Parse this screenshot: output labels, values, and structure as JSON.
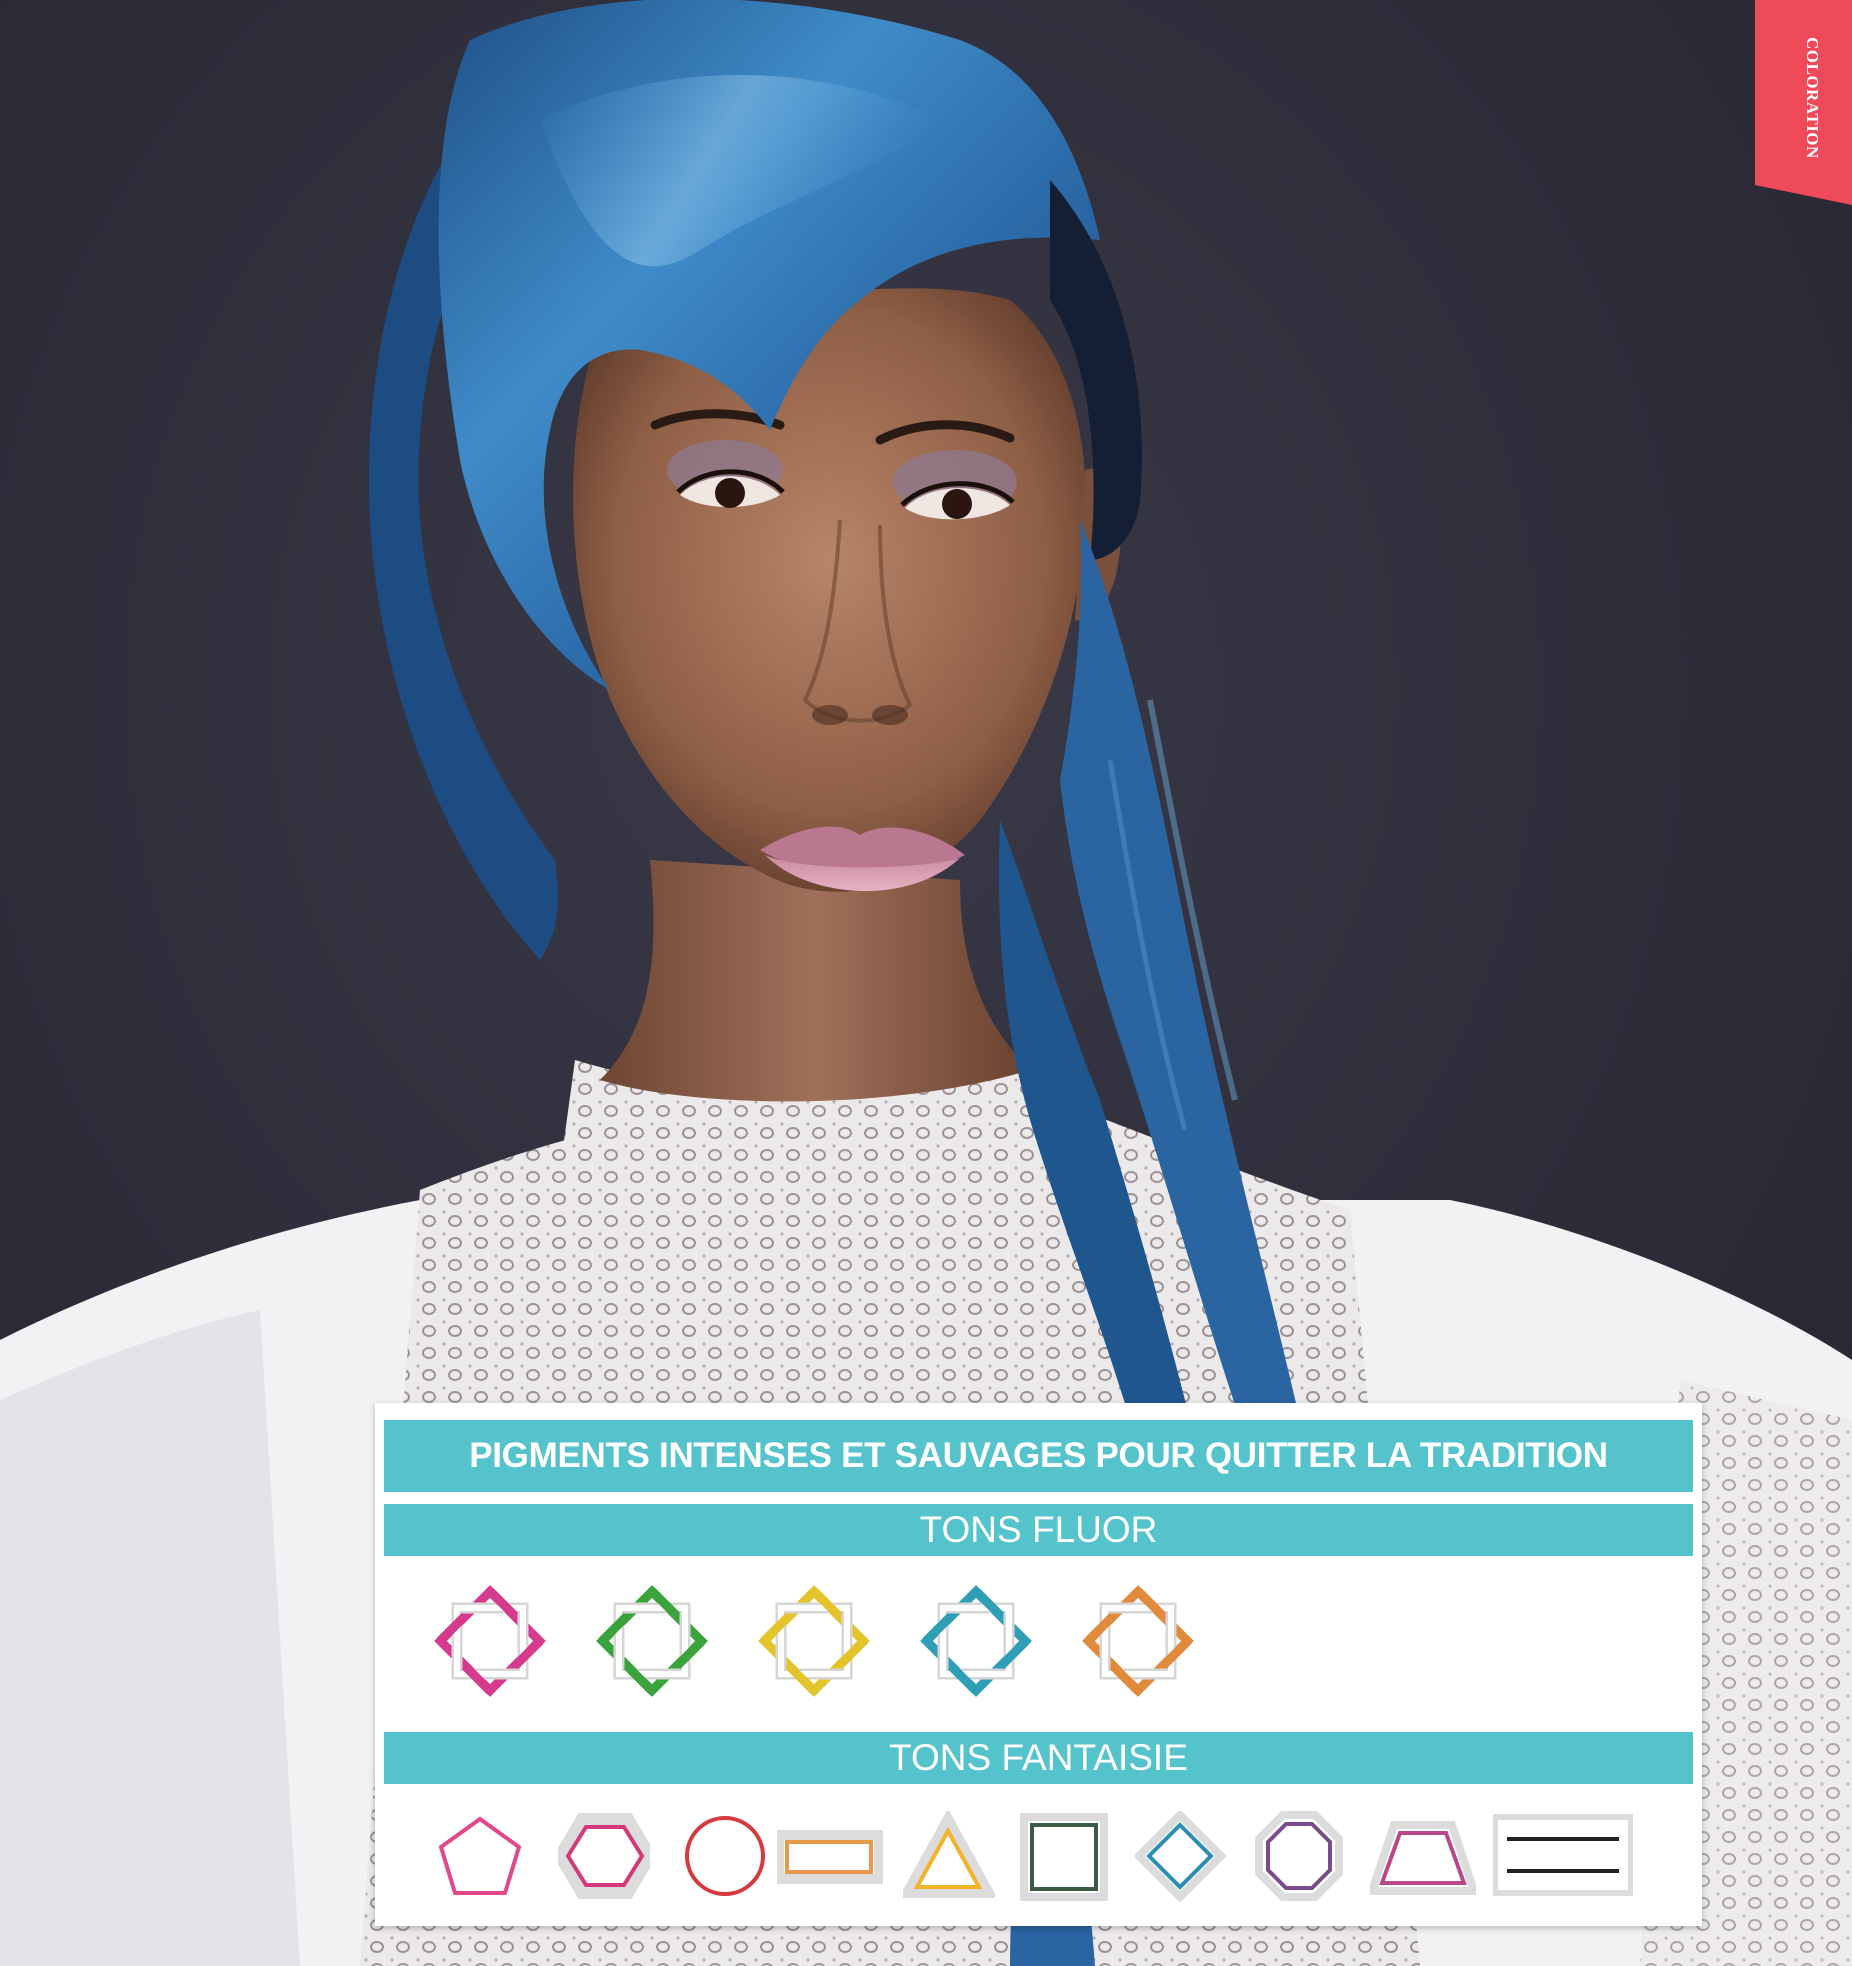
{
  "side_tab": {
    "label": "COLORATION",
    "color": "#ef4a5a"
  },
  "legend": {
    "band_color": "#55c3cc",
    "heading": "PIGMENTS INTENSES ET SAUVAGES POUR QUITTER LA TRADITION",
    "fluor": {
      "title": "TONS FLUOR",
      "symbols": [
        {
          "icon": "interlocked-octagon-icon",
          "color": "#d63a8c"
        },
        {
          "icon": "interlocked-octagon-icon",
          "color": "#3aa33c"
        },
        {
          "icon": "interlocked-octagon-icon",
          "color": "#e3c42a"
        },
        {
          "icon": "interlocked-octagon-icon",
          "color": "#2e9fb5"
        },
        {
          "icon": "interlocked-octagon-icon",
          "color": "#e08a3c"
        }
      ]
    },
    "fantaisie": {
      "title": "TONS FANTAISIE",
      "symbols": [
        {
          "icon": "pentagon-icon",
          "color": "#e0488a"
        },
        {
          "icon": "hexagon-icon",
          "color": "#d43a7a"
        },
        {
          "icon": "circle-icon",
          "color": "#d8393e"
        },
        {
          "icon": "rectangle-icon",
          "color": "#e89a4a"
        },
        {
          "icon": "triangle-icon",
          "color": "#f0b32a"
        },
        {
          "icon": "square-icon",
          "color": "#3a5a45"
        },
        {
          "icon": "diamond-icon",
          "color": "#2a8fb0"
        },
        {
          "icon": "octagon-icon",
          "color": "#7a4c8e"
        },
        {
          "icon": "trapezoid-icon",
          "color": "#b8488a"
        },
        {
          "icon": "double-line-rectangle-icon",
          "color": "#222222"
        }
      ]
    }
  }
}
